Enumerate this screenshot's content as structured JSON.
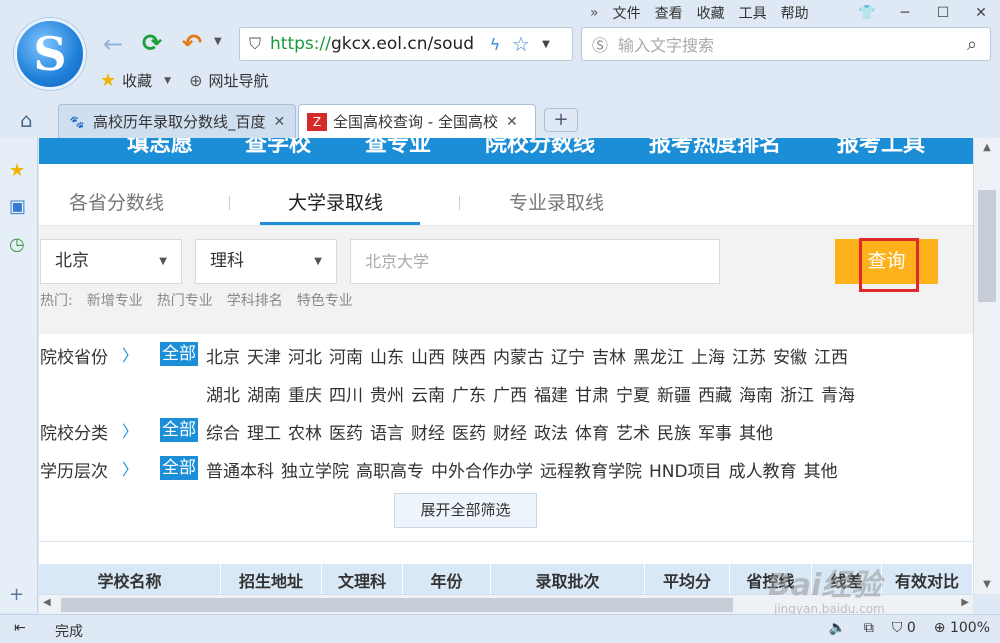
{
  "browser": {
    "menu": [
      "文件",
      "查看",
      "收藏",
      "工具",
      "帮助"
    ],
    "url_scheme": "https://",
    "url_rest": "gkcx.eol.cn/soud",
    "search_placeholder": "输入文字搜索",
    "bookmarks": {
      "favorites": "收藏",
      "site_nav": "网址导航"
    },
    "tabs": [
      {
        "title": "高校历年录取分数线_百度"
      },
      {
        "title": "全国高校查询 - 全国高校"
      }
    ],
    "status_text": "完成",
    "zoom": "100%",
    "shield_count": "0"
  },
  "page": {
    "top_nav": [
      "填志愿",
      "查学校",
      "查专业",
      "院校分数线",
      "报考热度排名",
      "报考工具"
    ],
    "sub_tabs": [
      "各省分数线",
      "大学录取线",
      "专业录取线"
    ],
    "province_select": "北京",
    "subject_select": "理科",
    "school_input_placeholder": "北京大学",
    "query_button": "查询",
    "hot_label": "热门:",
    "hot_links": [
      "新增专业",
      "热门专业",
      "学科排名",
      "特色专业"
    ],
    "facets": [
      {
        "label": "院校省份",
        "all": "全部",
        "options": [
          "北京",
          "天津",
          "河北",
          "河南",
          "山东",
          "山西",
          "陕西",
          "内蒙古",
          "辽宁",
          "吉林",
          "黑龙江",
          "上海",
          "江苏",
          "安徽",
          "江西"
        ]
      },
      {
        "label": "",
        "all": "",
        "options": [
          "湖北",
          "湖南",
          "重庆",
          "四川",
          "贵州",
          "云南",
          "广东",
          "广西",
          "福建",
          "甘肃",
          "宁夏",
          "新疆",
          "西藏",
          "海南",
          "浙江",
          "青海"
        ]
      },
      {
        "label": "院校分类",
        "all": "全部",
        "options": [
          "综合",
          "理工",
          "农林",
          "医药",
          "语言",
          "财经",
          "医药",
          "财经",
          "政法",
          "体育",
          "艺术",
          "民族",
          "军事",
          "其他"
        ]
      },
      {
        "label": "学历层次",
        "all": "全部",
        "options": [
          "普通本科",
          "独立学院",
          "高职高专",
          "中外合作办学",
          "远程教育学院",
          "HND项目",
          "成人教育",
          "其他"
        ]
      }
    ],
    "expand_button": "展开全部筛选",
    "table_headers": [
      "学校名称",
      "招生地址",
      "文理科",
      "年份",
      "录取批次",
      "平均分",
      "省控线",
      "线差",
      "有效对比"
    ]
  },
  "watermark": {
    "brand": "Bai经验",
    "domain": "jingyan.baidu.com"
  }
}
